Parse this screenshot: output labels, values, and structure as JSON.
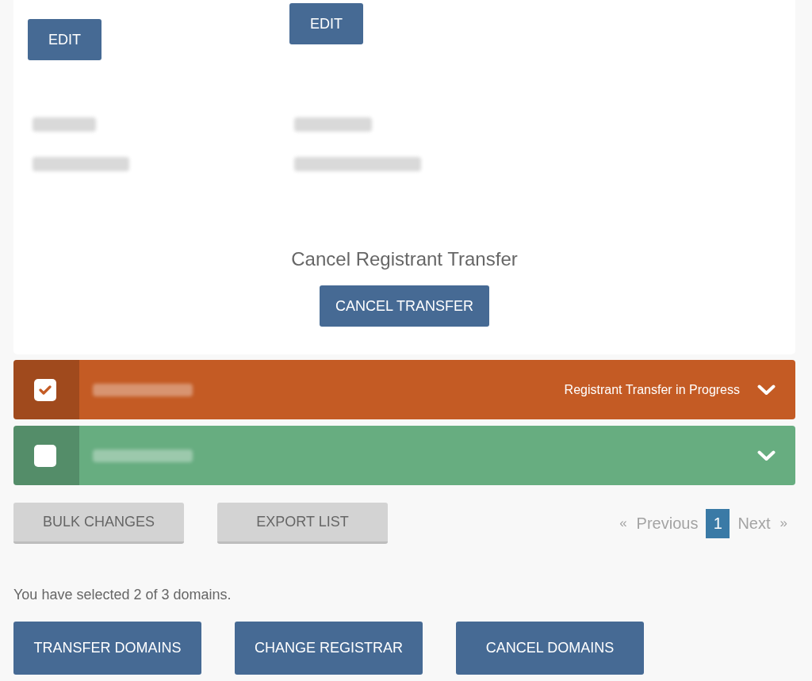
{
  "detail_columns": [
    {
      "edit_button": "EDIT"
    },
    {
      "edit_button": "EDIT"
    }
  ],
  "cancel_transfer": {
    "heading": "Cancel Registrant Transfer",
    "button": "CANCEL TRANSFER"
  },
  "domains": [
    {
      "checked": true,
      "color": "#c45b24",
      "status": "Registrant Transfer in Progress",
      "expanded": false
    },
    {
      "checked": false,
      "color": "#67ad80",
      "expanded": false
    }
  ],
  "list_buttons": [
    "BULK CHANGES",
    "EXPORT LIST"
  ],
  "pagination": {
    "previous": {
      "symbol": "«",
      "label": "Previous",
      "disabled": true
    },
    "pages": [
      {
        "label": "1",
        "selected": true
      }
    ],
    "next": {
      "label": "Next",
      "symbol": "»",
      "disabled": true
    }
  },
  "selection_text": "You have selected 2 of 3 domains.",
  "actions": [
    "TRANSFER DOMAINS",
    "CHANGE REGISTRAR",
    "CANCEL DOMAINS"
  ]
}
